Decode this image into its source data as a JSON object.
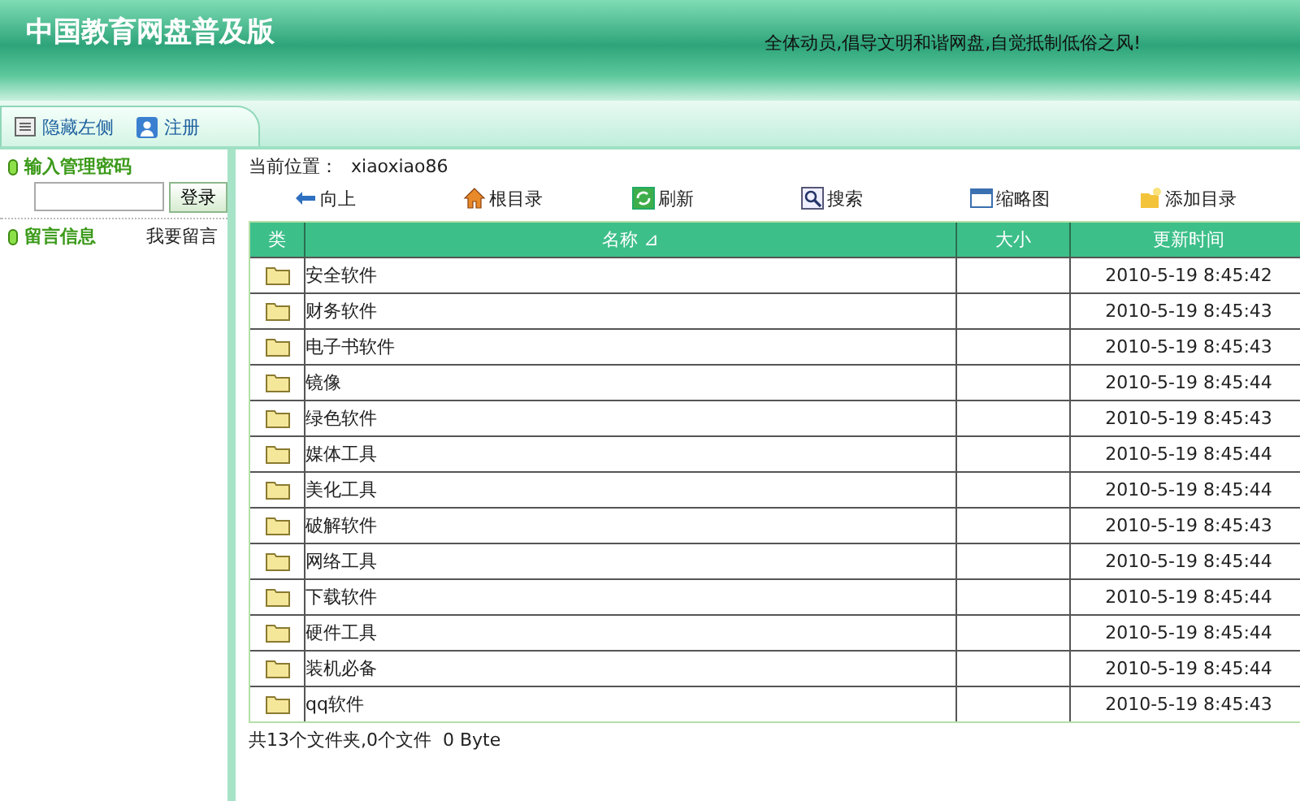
{
  "header": {
    "title": "中国教育网盘普及版",
    "slogan": "全体动员,倡导文明和谐网盘,自觉抵制低俗之风!"
  },
  "nav": [
    {
      "kind": "hide",
      "label": "隐藏左侧"
    },
    {
      "kind": "register",
      "label": "注册"
    }
  ],
  "sidebar": {
    "password_title": "输入管理密码",
    "login_button": "登录",
    "message_title": "留言信息",
    "message_link": "我要留言"
  },
  "location": {
    "label": "当前位置：",
    "value": "xiaoxiao86"
  },
  "toolbar": [
    {
      "kind": "up",
      "label": "向上"
    },
    {
      "kind": "home",
      "label": "根目录"
    },
    {
      "kind": "refresh",
      "label": "刷新"
    },
    {
      "kind": "search",
      "label": "搜索"
    },
    {
      "kind": "thumbs",
      "label": "缩略图"
    },
    {
      "kind": "newfolder",
      "label": "添加目录"
    }
  ],
  "table": {
    "columns": [
      "类",
      "名称 ⊿",
      "大小",
      "更新时间"
    ],
    "rows": [
      {
        "name": "安全软件",
        "time": "2010-5-19 8:45:42"
      },
      {
        "name": "财务软件",
        "time": "2010-5-19 8:45:43"
      },
      {
        "name": "电子书软件",
        "time": "2010-5-19 8:45:43"
      },
      {
        "name": "镜像",
        "time": "2010-5-19 8:45:44"
      },
      {
        "name": "绿色软件",
        "time": "2010-5-19 8:45:43"
      },
      {
        "name": "媒体工具",
        "time": "2010-5-19 8:45:44"
      },
      {
        "name": "美化工具",
        "time": "2010-5-19 8:45:44"
      },
      {
        "name": "破解软件",
        "time": "2010-5-19 8:45:43"
      },
      {
        "name": "网络工具",
        "time": "2010-5-19 8:45:44"
      },
      {
        "name": "下载软件",
        "time": "2010-5-19 8:45:44"
      },
      {
        "name": "硬件工具",
        "time": "2010-5-19 8:45:44"
      },
      {
        "name": "装机必备",
        "time": "2010-5-19 8:45:44"
      },
      {
        "name": "qq软件",
        "time": "2010-5-19 8:45:43"
      }
    ]
  },
  "summary": "共13个文件夹,0个文件  0 Byte"
}
